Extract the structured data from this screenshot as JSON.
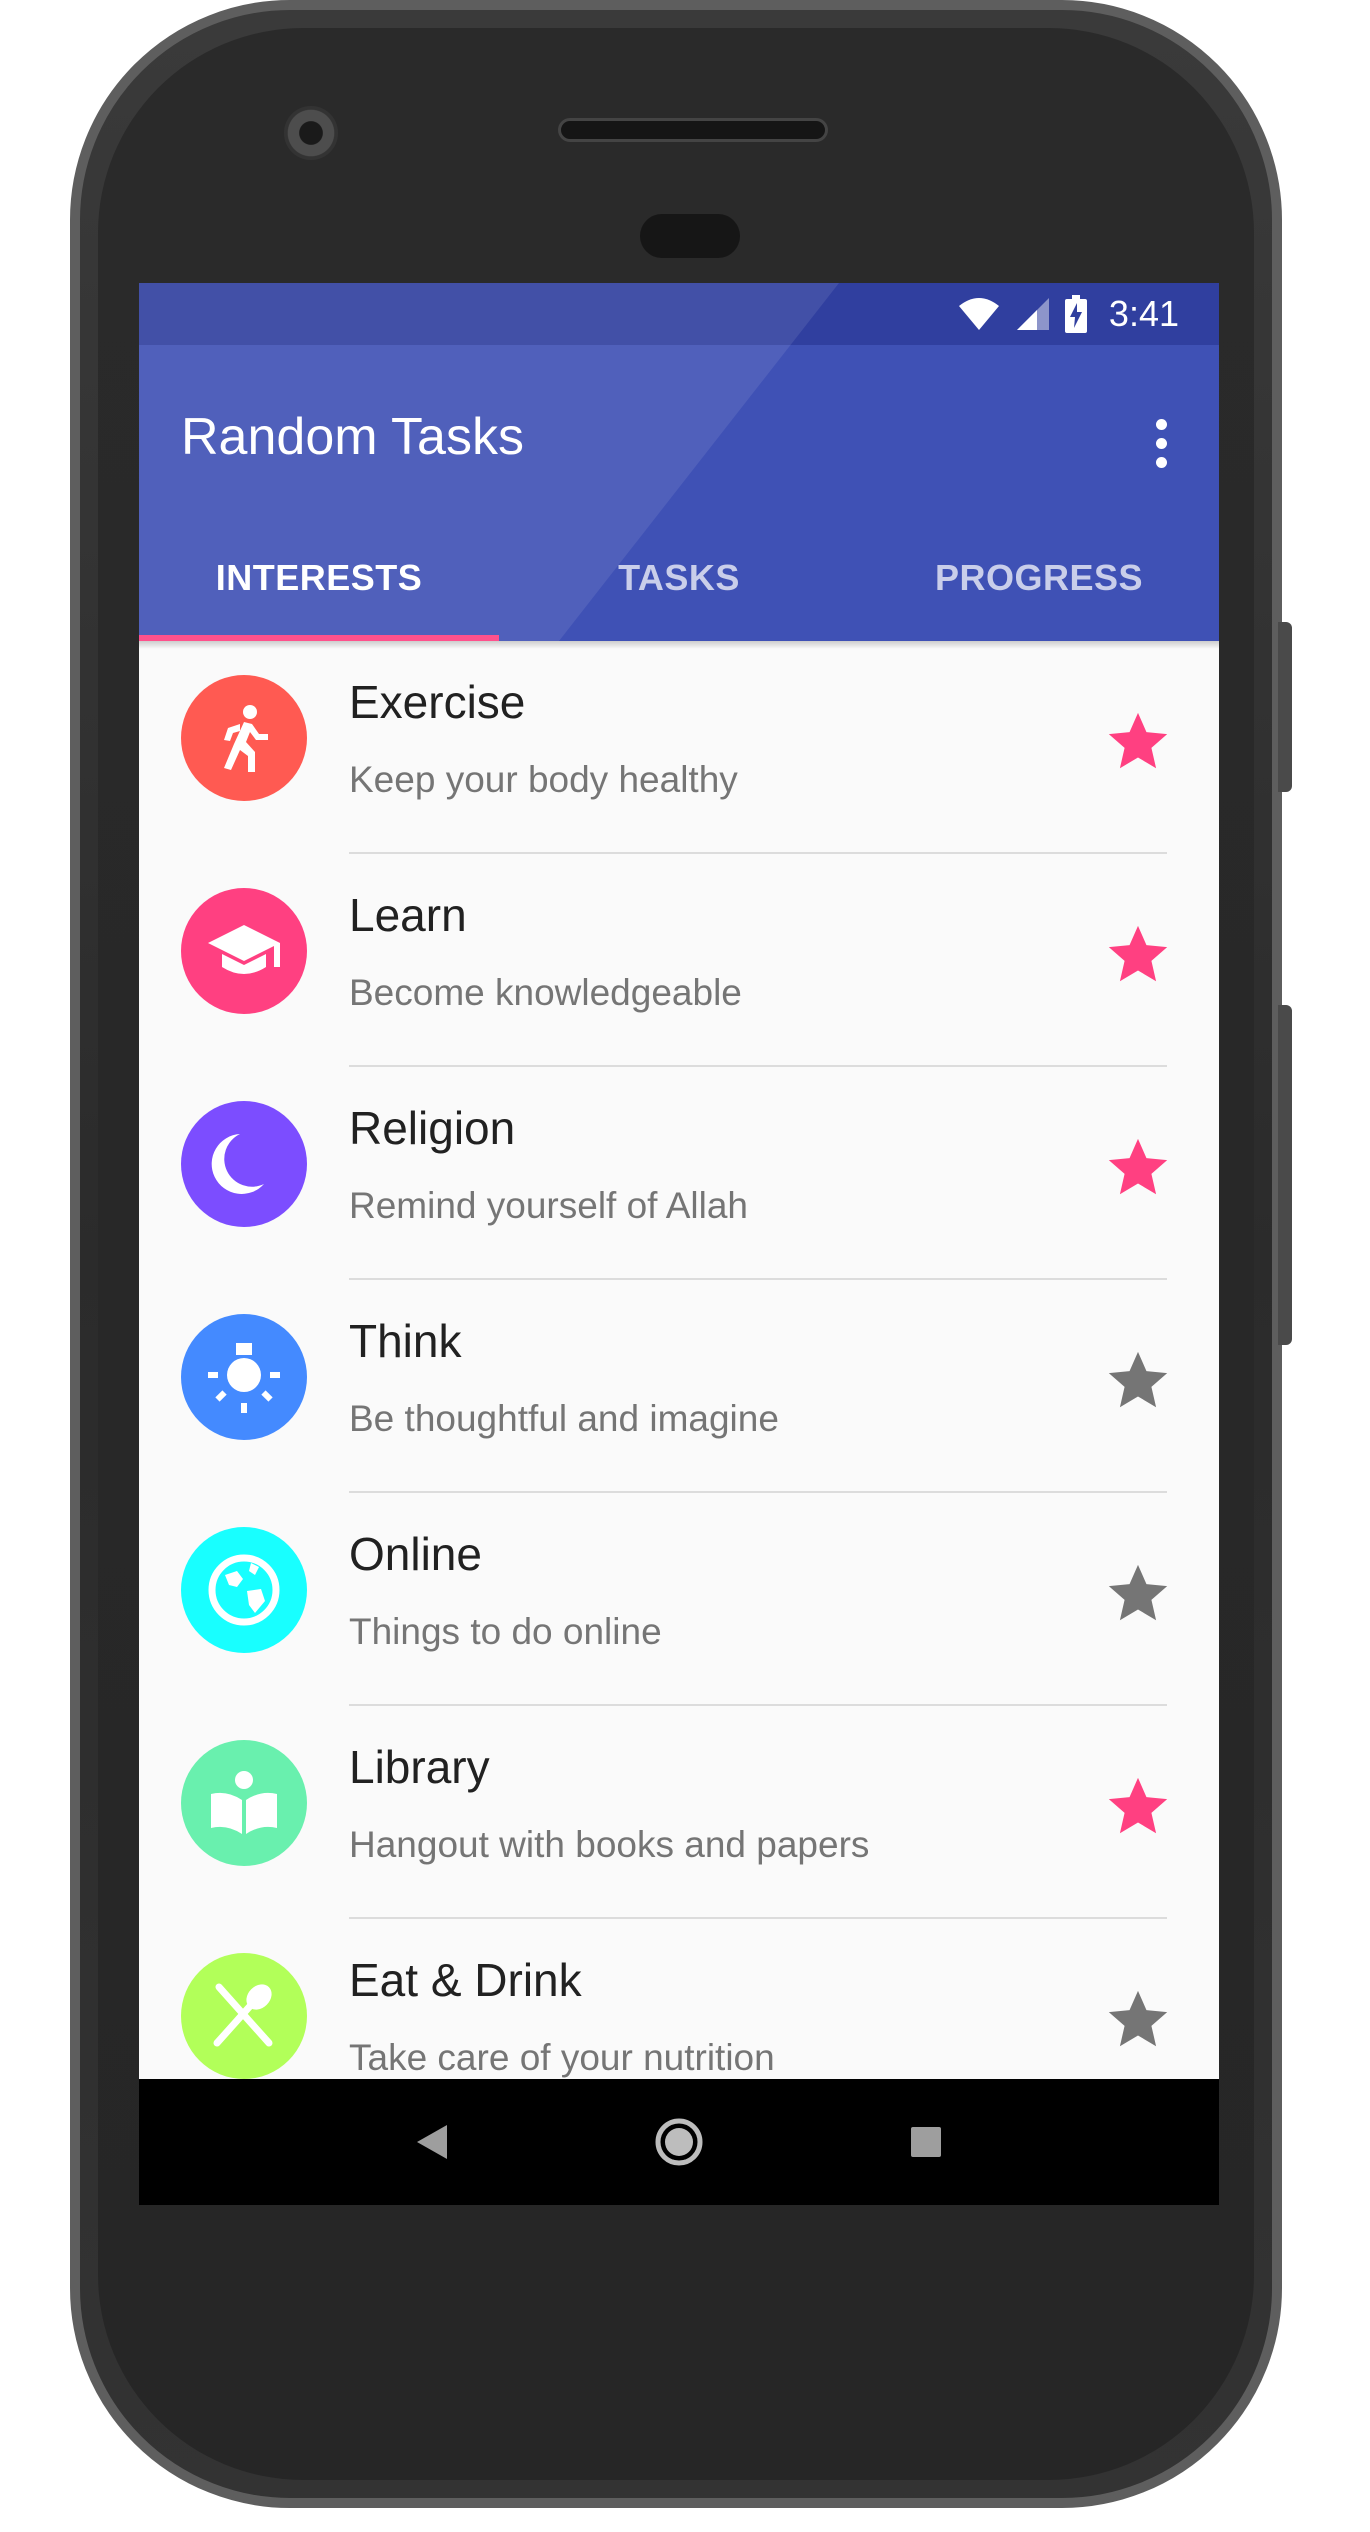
{
  "status_bar": {
    "time": "3:41",
    "icons": [
      "wifi-icon",
      "cell-signal-icon",
      "battery-charging-icon"
    ]
  },
  "app_bar": {
    "title": "Random Tasks",
    "overflow_icon": "more-vert-icon",
    "tabs": [
      {
        "label": "INTERESTS",
        "active": true
      },
      {
        "label": "TASKS",
        "active": false
      },
      {
        "label": "PROGRESS",
        "active": false
      }
    ]
  },
  "colors": {
    "primary": "#3f51b5",
    "primary_dark": "#303f9f",
    "accent": "#ff4081",
    "star_active": "#ff4081",
    "star_inactive": "#757575"
  },
  "interests": [
    {
      "title": "Exercise",
      "subtitle": "Keep your body healthy",
      "icon": "run-icon",
      "icon_color": "#ff5a52",
      "starred": true
    },
    {
      "title": "Learn",
      "subtitle": "Become knowledgeable",
      "icon": "graduation-cap-icon",
      "icon_color": "#ff4081",
      "starred": true
    },
    {
      "title": "Religion",
      "subtitle": "Remind yourself of Allah",
      "icon": "crescent-moon-icon",
      "icon_color": "#7c4dff",
      "starred": true
    },
    {
      "title": "Think",
      "subtitle": "Be thoughtful and imagine",
      "icon": "lightbulb-icon",
      "icon_color": "#448aff",
      "starred": false
    },
    {
      "title": "Online",
      "subtitle": "Things to do online",
      "icon": "globe-icon",
      "icon_color": "#18ffff",
      "starred": false
    },
    {
      "title": "Library",
      "subtitle": "Hangout with books and papers",
      "icon": "book-icon",
      "icon_color": "#69f0ae",
      "starred": true
    },
    {
      "title": "Eat & Drink",
      "subtitle": "Take care of your nutrition",
      "icon": "fork-spoon-icon",
      "icon_color": "#b2ff59",
      "starred": false
    }
  ],
  "nav_bar": {
    "buttons": [
      "back-icon",
      "home-icon",
      "recents-icon"
    ]
  }
}
